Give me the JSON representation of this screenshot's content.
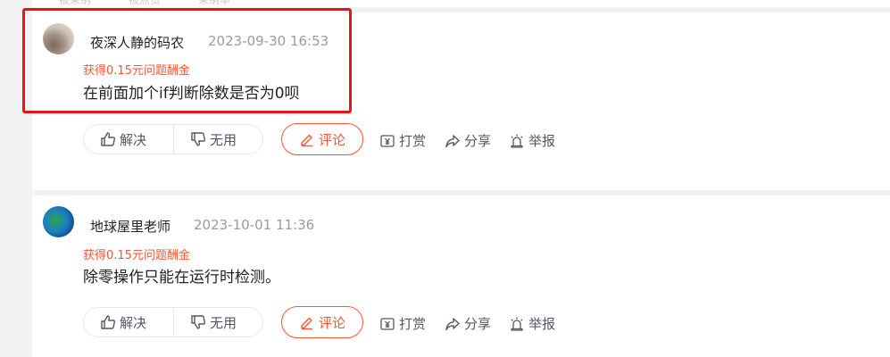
{
  "top_strip": {
    "items": [
      "被采纳",
      "被点赞",
      "采纳率"
    ]
  },
  "answers": [
    {
      "username": "夜深人静的码农",
      "timestamp": "2023-09-30 16:53",
      "reward": "获得0.15元问题酬金",
      "content": "在前面加个if判断除数是否为0呗",
      "vote_yes_label": "解决",
      "vote_no_label": "无用",
      "comment_label": "评论",
      "tip_label": "打赏",
      "share_label": "分享",
      "report_label": "举报"
    },
    {
      "username": "地球屋里老师",
      "timestamp": "2023-10-01 11:36",
      "reward": "获得0.15元问题酬金",
      "content": "除零操作只能在运行时检测。",
      "vote_yes_label": "解决",
      "vote_no_label": "无用",
      "comment_label": "评论",
      "tip_label": "打赏",
      "share_label": "分享",
      "report_label": "举报"
    }
  ],
  "icons": {
    "thumb_up": "thumb-up-icon",
    "thumb_down": "thumb-down-icon",
    "comment": "pencil-icon",
    "tip": "yen-icon",
    "share": "share-arrow-icon",
    "report": "alarm-icon"
  },
  "colors": {
    "accent": "#fc5531",
    "highlight": "#e8141a",
    "muted_text": "#999aaa",
    "body_text": "#222226"
  }
}
